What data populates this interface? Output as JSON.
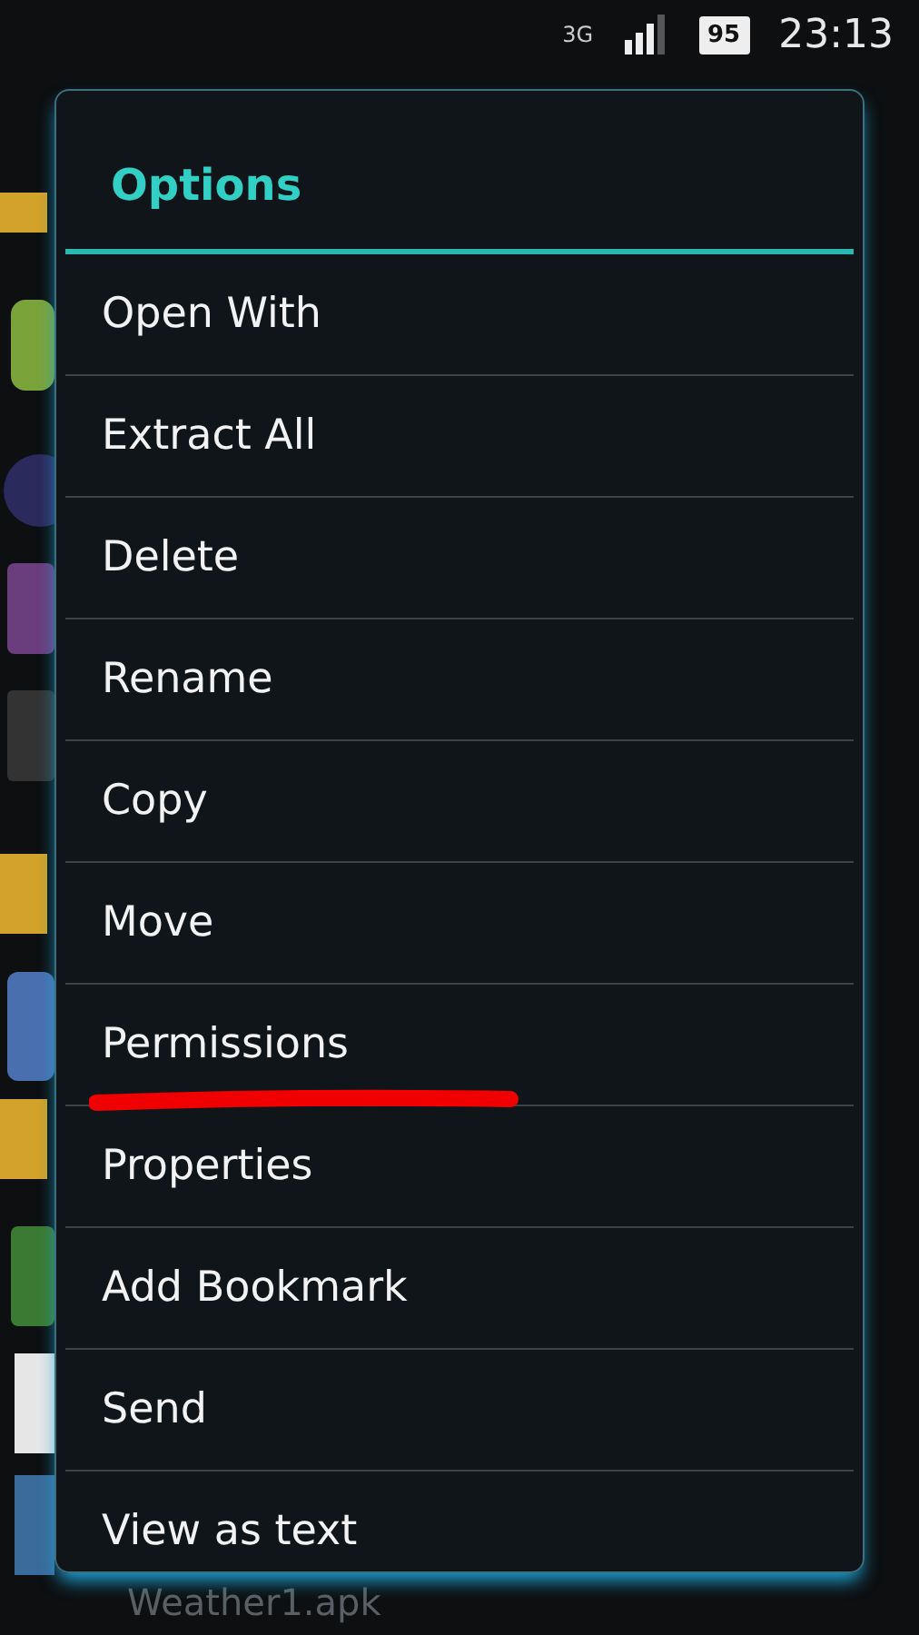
{
  "status_bar": {
    "network": "3G",
    "battery": "95",
    "time": "23:13"
  },
  "background_list": {
    "last_row": "Weather1.apk"
  },
  "dialog": {
    "title": "Options",
    "items": [
      {
        "label": "Open With",
        "underlined": false
      },
      {
        "label": "Extract All",
        "underlined": false
      },
      {
        "label": "Delete",
        "underlined": false
      },
      {
        "label": "Rename",
        "underlined": false
      },
      {
        "label": "Copy",
        "underlined": false
      },
      {
        "label": "Move",
        "underlined": false
      },
      {
        "label": "Permissions",
        "underlined": true
      },
      {
        "label": "Properties",
        "underlined": false
      },
      {
        "label": "Add Bookmark",
        "underlined": false
      },
      {
        "label": "Send",
        "underlined": false
      },
      {
        "label": "View as text",
        "underlined": false
      }
    ]
  }
}
